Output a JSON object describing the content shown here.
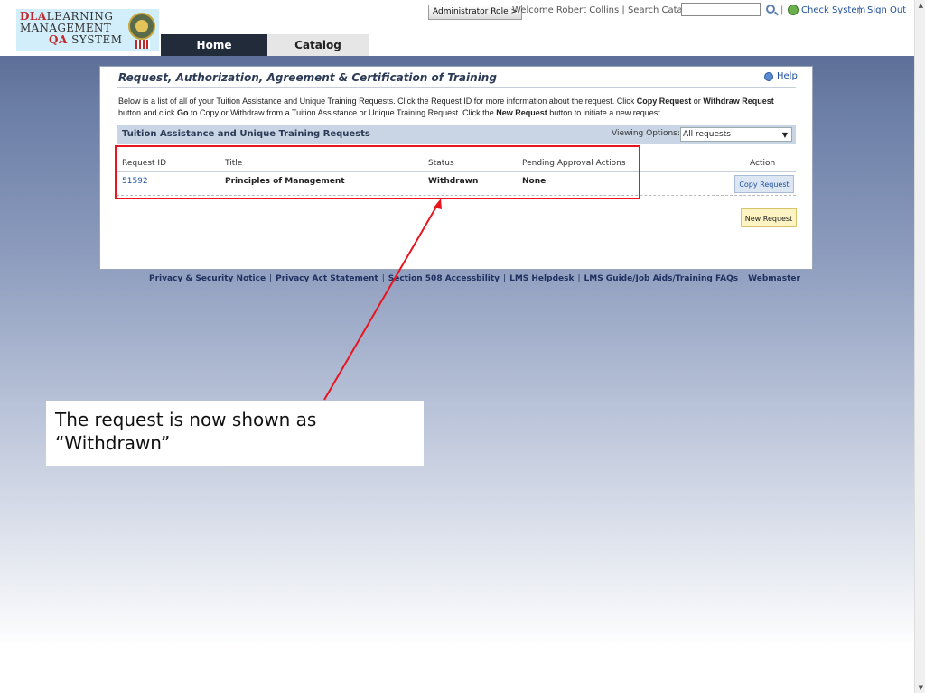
{
  "logo": {
    "line1_prefix": "DLA",
    "line1_rest": "LEARNING",
    "line2": "MANAGEMENT",
    "line3_qa": "QA",
    "line3_rest": "SYSTEM"
  },
  "nav": {
    "tabs": [
      {
        "label": "Home"
      },
      {
        "label": "Catalog"
      }
    ]
  },
  "header": {
    "admin_role": "Administrator Role >",
    "welcome": "Welcome Robert Collins | Search Catalog",
    "search_value": "",
    "sep": "|",
    "check_system": "Check System",
    "sign_out": "Sign Out"
  },
  "panel": {
    "title": "Request, Authorization, Agreement & Certification of Training",
    "help": "Help",
    "intro": {
      "p1": "Below is a list of all of your Tuition Assistance and Unique Training Requests. Click the Request ID for more information about the request. Click ",
      "b1": "Copy Request",
      "p2": " or ",
      "b2": "Withdraw Request",
      "p3": " button and click ",
      "b3": "Go",
      "p4": " to Copy or Withdraw from a Tuition Assistance or Unique Training Request. Click the ",
      "b4": "New Request",
      "p5": " button to initiate a new request."
    },
    "section_title": "Tuition Assistance and Unique Training Requests",
    "viewing_label": "Viewing Options:",
    "viewing_value": "All requests",
    "columns": [
      "Request ID",
      "Title",
      "Status",
      "Pending Approval Actions",
      "Action"
    ],
    "rows": [
      {
        "id": "51592",
        "title": "Principles of Management",
        "status": "Withdrawn",
        "pending": "None",
        "action": "Copy Request"
      }
    ],
    "new_request": "New Request"
  },
  "footer": {
    "links": [
      "Privacy & Security Notice",
      "Privacy Act Statement",
      "Section 508 Accessbility",
      "LMS Helpdesk",
      "LMS Guide/Job Aids/Training FAQs",
      "Webmaster"
    ],
    "sep": "|"
  },
  "callout": {
    "text": "The request is now shown as “Withdrawn”"
  },
  "colors": {
    "highlight": "#e8141e",
    "header_dark": "#222b3a",
    "link": "#1d4f9c"
  }
}
